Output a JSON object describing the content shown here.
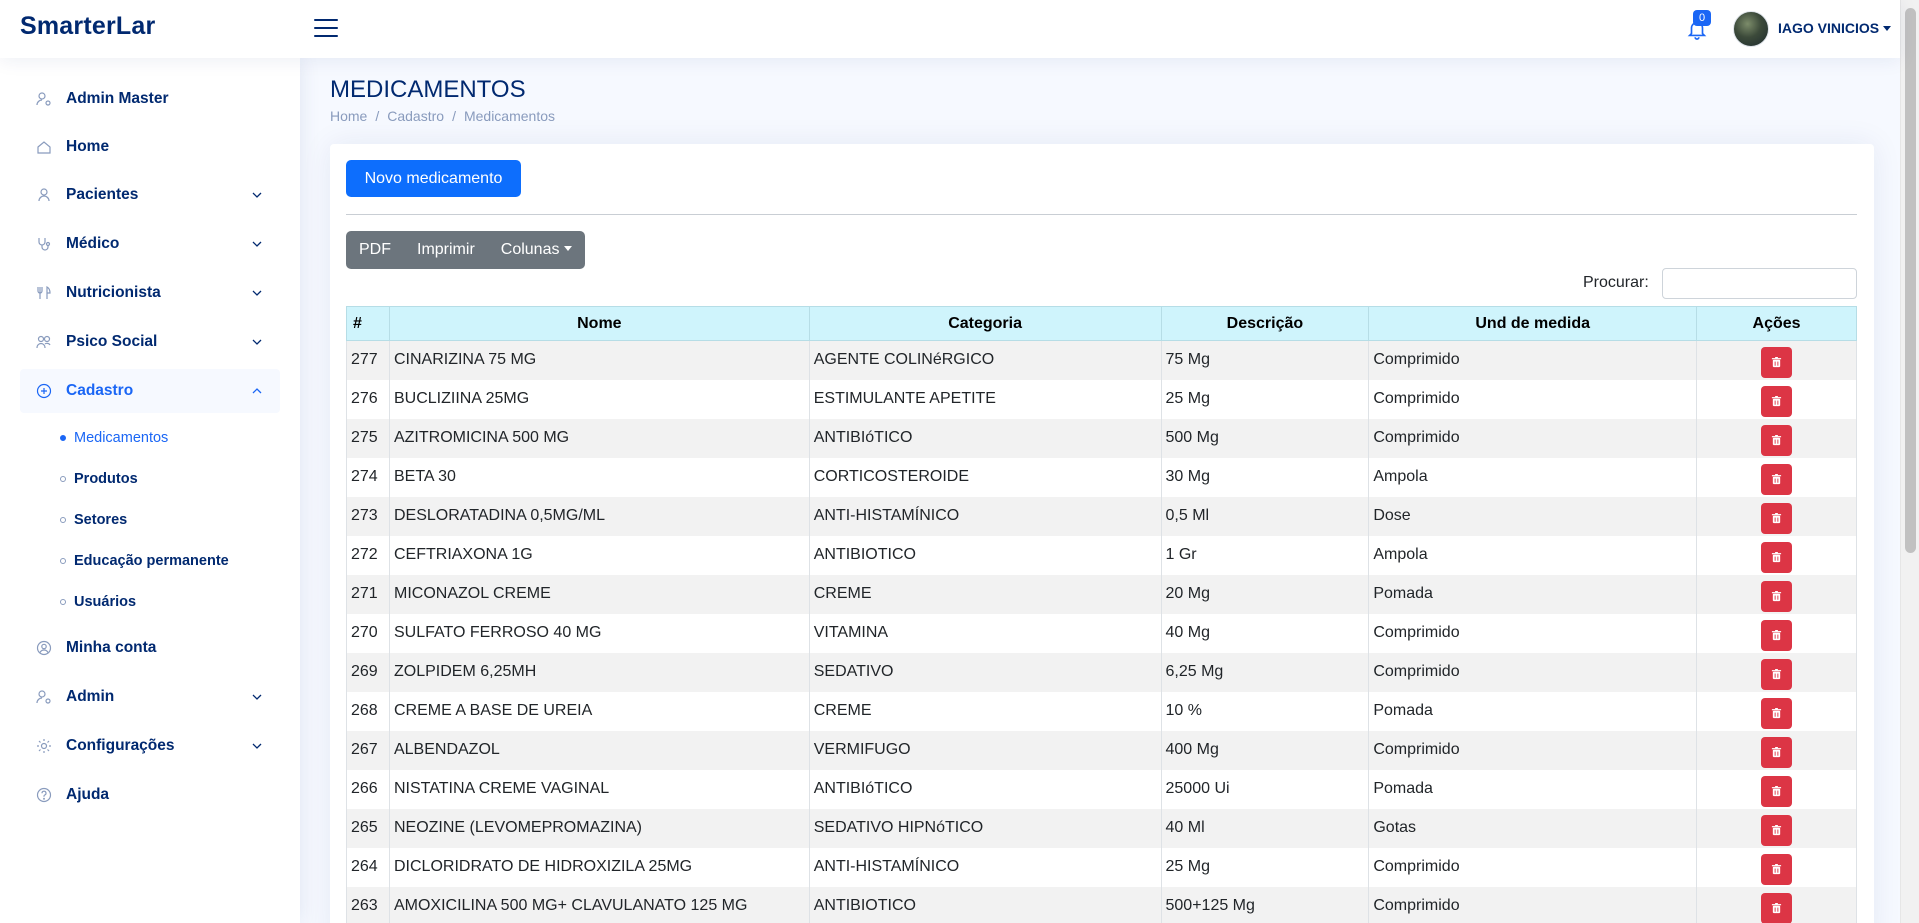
{
  "header": {
    "brand": "SmarterLar",
    "notifications_count": "0",
    "user_name": "IAGO VINICIOS"
  },
  "sidebar": {
    "items": [
      {
        "label": "Admin Master",
        "icon": "person-gear-icon"
      },
      {
        "label": "Home",
        "icon": "house-icon"
      },
      {
        "label": "Pacientes",
        "icon": "person-icon"
      },
      {
        "label": "Médico",
        "icon": "stethoscope-icon"
      },
      {
        "label": "Nutricionista",
        "icon": "cutlery-icon"
      },
      {
        "label": "Psico Social",
        "icon": "people-icon"
      },
      {
        "label": "Cadastro",
        "icon": "plus-circle-icon"
      },
      {
        "label": "Minha conta",
        "icon": "person-circle-icon"
      },
      {
        "label": "Admin",
        "icon": "person-gear-icon"
      },
      {
        "label": "Configurações",
        "icon": "gear-icon"
      },
      {
        "label": "Ajuda",
        "icon": "question-circle-icon"
      }
    ],
    "sub_items": [
      {
        "label": "Medicamentos"
      },
      {
        "label": "Produtos"
      },
      {
        "label": "Setores"
      },
      {
        "label": "Educação permanente"
      },
      {
        "label": "Usuários"
      }
    ]
  },
  "page": {
    "title": "MEDICAMENTOS",
    "breadcrumb": [
      "Home",
      "Cadastro",
      "Medicamentos"
    ]
  },
  "toolbar": {
    "new_label": "Novo medicamento",
    "pdf_label": "PDF",
    "print_label": "Imprimir",
    "columns_label": "Colunas",
    "search_label": "Procurar:",
    "search_value": ""
  },
  "table": {
    "columns": [
      "#",
      "Nome",
      "Categoria",
      "Descrição",
      "Und de medida",
      "Ações"
    ],
    "rows": [
      [
        "277",
        "CINARIZINA 75 MG",
        "AGENTE COLINéRGICO",
        "75 Mg",
        "Comprimido"
      ],
      [
        "276",
        "BUCLIZIINA 25MG",
        "ESTIMULANTE APETITE",
        "25 Mg",
        "Comprimido"
      ],
      [
        "275",
        "AZITROMICINA 500 MG",
        "ANTIBIóTICO",
        "500 Mg",
        "Comprimido"
      ],
      [
        "274",
        "BETA 30",
        "CORTICOSTEROIDE",
        "30 Mg",
        "Ampola"
      ],
      [
        "273",
        "DESLORATADINA 0,5MG/ML",
        "ANTI-HISTAMÍNICO",
        "0,5 Ml",
        "Dose"
      ],
      [
        "272",
        "CEFTRIAXONA 1G",
        "ANTIBIOTICO",
        "1 Gr",
        "Ampola"
      ],
      [
        "271",
        "MICONAZOL CREME",
        "CREME",
        "20 Mg",
        "Pomada"
      ],
      [
        "270",
        "SULFATO FERROSO 40 MG",
        "VITAMINA",
        "40 Mg",
        "Comprimido"
      ],
      [
        "269",
        "ZOLPIDEM 6,25MH",
        "SEDATIVO",
        "6,25 Mg",
        "Comprimido"
      ],
      [
        "268",
        "CREME A BASE DE UREIA",
        "CREME",
        "10 %",
        "Pomada"
      ],
      [
        "267",
        "ALBENDAZOL",
        "VERMIFUGO",
        "400 Mg",
        "Comprimido"
      ],
      [
        "266",
        "NISTATINA CREME VAGINAL",
        "ANTIBIóTICO",
        "25000 Ui",
        "Pomada"
      ],
      [
        "265",
        "NEOZINE (LEVOMEPROMAZINA)",
        "SEDATIVO HIPNóTICO",
        "40 Ml",
        "Gotas"
      ],
      [
        "264",
        "DICLORIDRATO DE HIDROXIZILA 25MG",
        "ANTI-HISTAMÍNICO",
        "25 Mg",
        "Comprimido"
      ],
      [
        "263",
        "AMOXICILINA 500 MG+ CLAVULANATO 125 MG",
        "ANTIBIOTICO",
        "500+125 Mg",
        "Comprimido"
      ]
    ]
  },
  "colors": {
    "brand": "#012970",
    "primary": "#0d6efd",
    "danger": "#dc3545",
    "table_header": "#cff4fc"
  }
}
